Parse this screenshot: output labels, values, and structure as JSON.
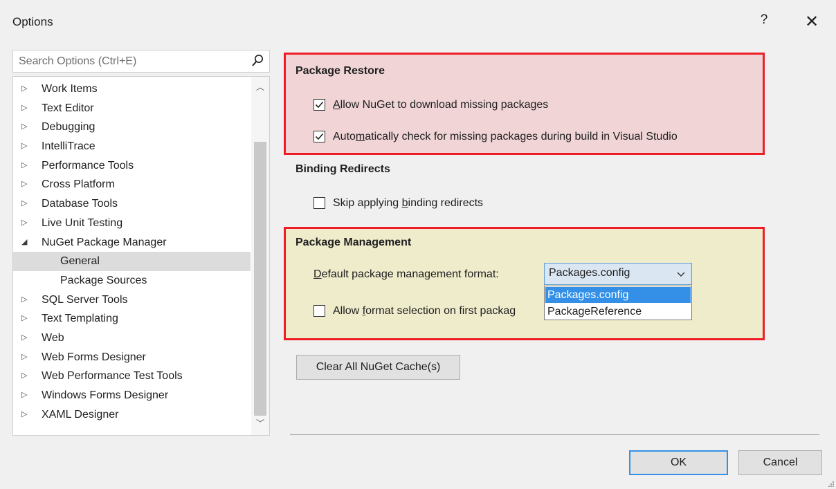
{
  "window": {
    "title": "Options",
    "help_label": "?",
    "close_label": "✕"
  },
  "search": {
    "placeholder": "Search Options (Ctrl+E)",
    "icon": "search-icon"
  },
  "tree": {
    "items": [
      {
        "label": "Work Items",
        "arrow": "▷"
      },
      {
        "label": "Text Editor",
        "arrow": "▷"
      },
      {
        "label": "Debugging",
        "arrow": "▷"
      },
      {
        "label": "IntelliTrace",
        "arrow": "▷"
      },
      {
        "label": "Performance Tools",
        "arrow": "▷"
      },
      {
        "label": "Cross Platform",
        "arrow": "▷"
      },
      {
        "label": "Database Tools",
        "arrow": "▷"
      },
      {
        "label": "Live Unit Testing",
        "arrow": "▷"
      },
      {
        "label": "NuGet Package Manager",
        "arrow": "◢"
      },
      {
        "label": "General",
        "arrow": "",
        "selected": true
      },
      {
        "label": "Package Sources",
        "arrow": ""
      },
      {
        "label": "SQL Server Tools",
        "arrow": "▷"
      },
      {
        "label": "Text Templating",
        "arrow": "▷"
      },
      {
        "label": "Web",
        "arrow": "▷"
      },
      {
        "label": "Web Forms Designer",
        "arrow": "▷"
      },
      {
        "label": "Web Performance Test Tools",
        "arrow": "▷"
      },
      {
        "label": "Windows Forms Designer",
        "arrow": "▷"
      },
      {
        "label": "XAML Designer",
        "arrow": "▷"
      }
    ]
  },
  "package_restore": {
    "heading": "Package Restore",
    "allow_download": {
      "label_ul": "A",
      "label_rest": "llow NuGet to download missing packages",
      "checked": true
    },
    "auto_check": {
      "label_pre": "Auto",
      "label_ul": "m",
      "label_rest": "atically check for missing packages during build in Visual Studio",
      "checked": true
    }
  },
  "binding_redirects": {
    "heading": "Binding Redirects",
    "skip": {
      "label_pre": "Skip applying ",
      "label_ul": "b",
      "label_rest": "inding redirects",
      "checked": false
    }
  },
  "package_management": {
    "heading": "Package Management",
    "format_label_ul": "D",
    "format_label_rest": "efault package management format:",
    "format_value": "Packages.config",
    "format_options": [
      "Packages.config",
      "PackageReference"
    ],
    "allow_selection": {
      "label_pre": "Allow ",
      "label_ul": "f",
      "label_rest": "ormat selection on first packag",
      "checked": false
    }
  },
  "buttons": {
    "clear_cache": "Clear All NuGet Cache(s)",
    "ok": "OK",
    "cancel": "Cancel"
  },
  "colors": {
    "restore_bg": "#f0d4d6",
    "mgmt_bg": "#efeccc",
    "highlight_border": "#ee1c24",
    "accent": "#3390e6"
  }
}
